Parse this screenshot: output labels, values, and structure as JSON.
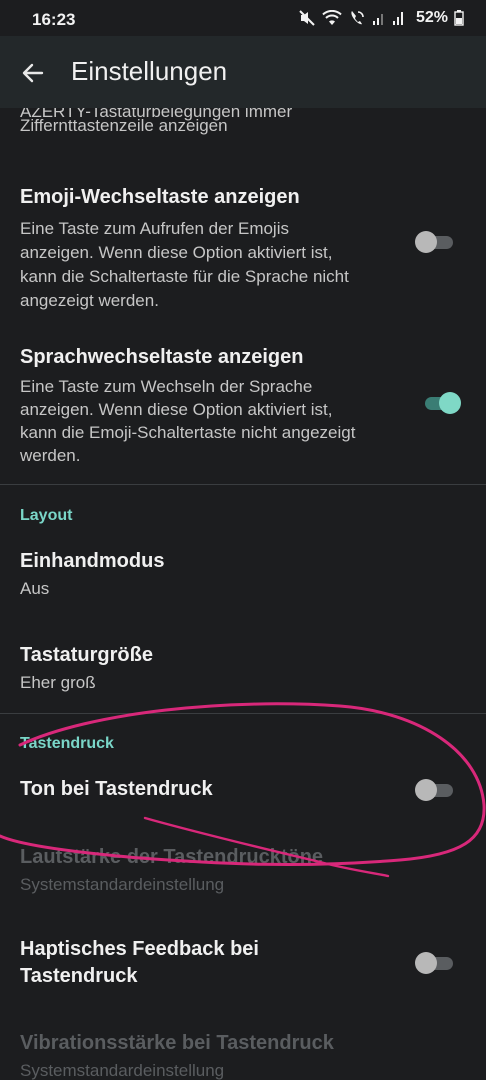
{
  "status_bar": {
    "time": "16:23",
    "battery": "52%",
    "icons": [
      "mute-icon",
      "wifi-icon",
      "wifi-calling-icon",
      "signal-icon",
      "signal-icon",
      "battery-icon"
    ]
  },
  "app_bar": {
    "title": "Einstellungen",
    "back_icon": "arrow-back-icon"
  },
  "settings": {
    "partial_summary_line1": "AZERTY-Tastaturbelegungen immer",
    "partial_summary_line2": "Ziffernttastenzeile anzeigen",
    "emoji_switch": {
      "title": "Emoji-Wechseltaste anzeigen",
      "summary_lines": [
        "Eine Taste zum Aufrufen der Emojis",
        "anzeigen. Wenn diese Option aktiviert ist,",
        "kann die Schaltertaste für die Sprache nicht",
        "angezeigt werden."
      ],
      "enabled": false
    },
    "language_switch": {
      "title": "Sprachwechseltaste anzeigen",
      "summary_lines": [
        "Eine Taste zum Wechseln der Sprache",
        "anzeigen. Wenn diese Option aktiviert ist,",
        "kann die Emoji-Schaltertaste nicht angezeigt",
        "werden."
      ],
      "enabled": true
    },
    "layout_header": "Layout",
    "one_hand": {
      "title": "Einhandmodus",
      "summary": "Aus"
    },
    "keyboard_size": {
      "title": "Tastaturgröße",
      "summary": "Eher groß"
    },
    "keypress_header": "Tastendruck",
    "sound_on_keypress": {
      "title": "Ton bei Tastendruck",
      "enabled": false
    },
    "keypress_volume": {
      "title": "Lautstärke der Tastendrucktöne",
      "summary": "Systemstandardeinstellung"
    },
    "haptic_feedback": {
      "title_lines": [
        "Haptisches Feedback bei",
        "Tastendruck"
      ],
      "enabled": false
    },
    "vibration_strength": {
      "title": "Vibrationsstärke bei Tastendruck",
      "summary": "Systemstandardeinstellung"
    }
  },
  "colors": {
    "background": "#1c1d1f",
    "app_bar": "#23282a",
    "accent": "#7fd8c6",
    "annotation": "#d8287a"
  }
}
